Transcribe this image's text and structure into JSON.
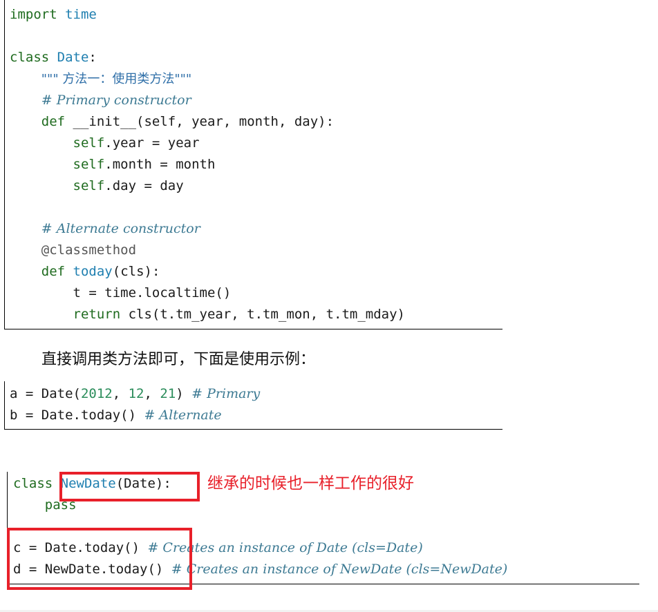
{
  "block1": {
    "lines": [
      [
        {
          "t": "import",
          "c": "kw"
        },
        {
          "t": " "
        },
        {
          "t": "time",
          "c": "nm"
        }
      ],
      [],
      [
        {
          "t": "class",
          "c": "kw"
        },
        {
          "t": " "
        },
        {
          "t": "Date",
          "c": "nm"
        },
        {
          "t": ":"
        }
      ],
      [
        {
          "t": "    "
        },
        {
          "t": "\"\"\" 方法一：使用类方法\"\"\"",
          "c": "str"
        }
      ],
      [
        {
          "t": "    "
        },
        {
          "t": "# Primary constructor",
          "c": "cm"
        }
      ],
      [
        {
          "t": "    "
        },
        {
          "t": "def",
          "c": "kw"
        },
        {
          "t": " __init__(self, year, month, day):"
        }
      ],
      [
        {
          "t": "        "
        },
        {
          "t": "self",
          "c": "kw"
        },
        {
          "t": ".year = year"
        }
      ],
      [
        {
          "t": "        "
        },
        {
          "t": "self",
          "c": "kw"
        },
        {
          "t": ".month = month"
        }
      ],
      [
        {
          "t": "        "
        },
        {
          "t": "self",
          "c": "kw"
        },
        {
          "t": ".day = day"
        }
      ],
      [],
      [
        {
          "t": "    "
        },
        {
          "t": "# Alternate constructor",
          "c": "cm"
        }
      ],
      [
        {
          "t": "    "
        },
        {
          "t": "@classmethod",
          "c": "dec"
        }
      ],
      [
        {
          "t": "    "
        },
        {
          "t": "def",
          "c": "kw"
        },
        {
          "t": " "
        },
        {
          "t": "today",
          "c": "nm"
        },
        {
          "t": "(cls):"
        }
      ],
      [
        {
          "t": "        t = time.localtime()"
        }
      ],
      [
        {
          "t": "        "
        },
        {
          "t": "return",
          "c": "kw"
        },
        {
          "t": " cls(t.tm_year, t.tm_mon, t.tm_mday)"
        }
      ]
    ]
  },
  "prose": "直接调用类方法即可，下面是使用示例：",
  "block2": {
    "lines": [
      [
        {
          "t": "a = Date("
        },
        {
          "t": "2012",
          "c": "num"
        },
        {
          "t": ", "
        },
        {
          "t": "12",
          "c": "num"
        },
        {
          "t": ", "
        },
        {
          "t": "21",
          "c": "num"
        },
        {
          "t": ") "
        },
        {
          "t": "# Primary",
          "c": "cm"
        }
      ],
      [
        {
          "t": "b = Date.today() "
        },
        {
          "t": "# Alternate",
          "c": "cm"
        }
      ]
    ]
  },
  "block3": {
    "lines": [
      [
        {
          "t": "class",
          "c": "kw"
        },
        {
          "t": " "
        },
        {
          "t": "NewDate",
          "c": "nm"
        },
        {
          "t": "(Date):"
        }
      ],
      [
        {
          "t": "    "
        },
        {
          "t": "pass",
          "c": "kw"
        }
      ],
      [],
      [
        {
          "t": "c = Date.today() "
        },
        {
          "t": "# Creates an instance of Date (cls=Date)",
          "c": "cm"
        }
      ],
      [
        {
          "t": "d = NewDate.today() "
        },
        {
          "t": "# Creates an instance of NewDate (cls=NewDate)",
          "c": "cm"
        }
      ]
    ]
  },
  "annotation": "继承的时候也一样工作的很好",
  "colors": {
    "highlight": "#e8202a"
  }
}
